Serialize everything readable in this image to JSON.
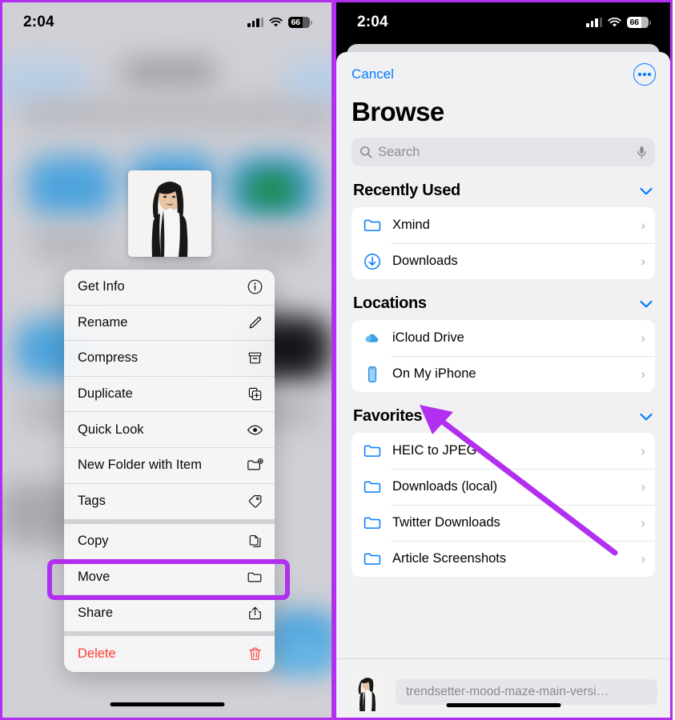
{
  "annotation": {
    "highlight_color": "#b22ff0",
    "arrow_target": "On My iPhone",
    "frame_color": "#b22ff0"
  },
  "left_panel": {
    "status_bar": {
      "time": "2:04",
      "battery": "66",
      "cellular_icon": "signal-bars-icon",
      "wifi_icon": "wifi-icon",
      "battery_icon": "battery-icon"
    },
    "background": {
      "description": "blurred Files app browse grid",
      "thumbnail_icon": "photo-thumbnail"
    },
    "context_menu": {
      "groups": [
        {
          "items": [
            {
              "label": "Get Info",
              "icon": "info-circle-icon",
              "destructive": false
            },
            {
              "label": "Rename",
              "icon": "pencil-icon",
              "destructive": false
            },
            {
              "label": "Compress",
              "icon": "archive-box-icon",
              "destructive": false
            },
            {
              "label": "Duplicate",
              "icon": "duplicate-plus-icon",
              "destructive": false
            },
            {
              "label": "Quick Look",
              "icon": "eye-icon",
              "destructive": false
            },
            {
              "label": "New Folder with Item",
              "icon": "folder-plus-icon",
              "destructive": false
            },
            {
              "label": "Tags",
              "icon": "tag-icon",
              "destructive": false
            }
          ]
        },
        {
          "items": [
            {
              "label": "Copy",
              "icon": "copy-documents-icon",
              "destructive": false
            },
            {
              "label": "Move",
              "icon": "folder-icon",
              "destructive": false,
              "highlighted": true
            },
            {
              "label": "Share",
              "icon": "share-up-arrow-icon",
              "destructive": false
            }
          ]
        },
        {
          "items": [
            {
              "label": "Delete",
              "icon": "trash-icon",
              "destructive": true
            }
          ]
        }
      ]
    }
  },
  "right_panel": {
    "status_bar": {
      "time": "2:04",
      "battery": "66",
      "cellular_icon": "signal-bars-icon",
      "wifi_icon": "wifi-icon",
      "battery_icon": "battery-icon"
    },
    "sheet": {
      "cancel_label": "Cancel",
      "more_icon": "more-circle-icon",
      "title": "Browse",
      "search": {
        "placeholder": "Search",
        "search_icon": "search-icon",
        "mic_icon": "microphone-icon"
      },
      "sections": [
        {
          "title": "Recently Used",
          "collapse_icon": "chevron-down-icon",
          "rows": [
            {
              "label": "Xmind",
              "icon": "folder-icon",
              "chevron": "›"
            },
            {
              "label": "Downloads",
              "icon": "download-circle-icon",
              "chevron": "›"
            }
          ]
        },
        {
          "title": "Locations",
          "collapse_icon": "chevron-down-icon",
          "rows": [
            {
              "label": "iCloud Drive",
              "icon": "icloud-drive-icon",
              "chevron": "›"
            },
            {
              "label": "On My iPhone",
              "icon": "iphone-icon",
              "chevron": "›"
            }
          ]
        },
        {
          "title": "Favorites",
          "collapse_icon": "chevron-down-icon",
          "rows": [
            {
              "label": "HEIC to JPEG",
              "icon": "folder-icon",
              "chevron": "›"
            },
            {
              "label": "Downloads (local)",
              "icon": "folder-icon",
              "chevron": "›"
            },
            {
              "label": "Twitter Downloads",
              "icon": "folder-icon",
              "chevron": "›"
            },
            {
              "label": "Article Screenshots",
              "icon": "folder-icon",
              "chevron": "›"
            }
          ]
        }
      ],
      "bottom_bar": {
        "file_thumbnail_icon": "file-photo-thumbnail",
        "file_name": "trendsetter-mood-maze-main-versi…"
      }
    }
  }
}
